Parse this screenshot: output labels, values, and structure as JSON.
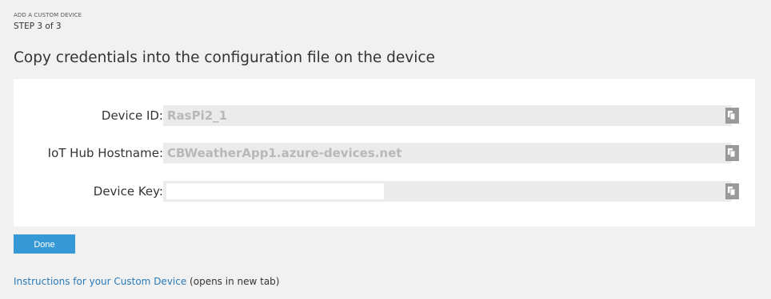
{
  "wizard": {
    "title": "ADD A CUSTOM DEVICE",
    "step": "STEP 3 of 3"
  },
  "heading": "Copy credentials into the configuration file on the device",
  "fields": [
    {
      "label": "Device ID:",
      "value": "RasPi2_1",
      "copy_icon": "copy-icon"
    },
    {
      "label": "IoT Hub Hostname:",
      "value": "CBWeatherApp1.azure-devices.net",
      "copy_icon": "copy-icon"
    },
    {
      "label": "Device Key:",
      "value": "",
      "copy_icon": "copy-icon"
    }
  ],
  "actions": {
    "done_label": "Done"
  },
  "footer": {
    "link_text": "Instructions for your Custom Device",
    "suffix": " (opens in new tab)"
  },
  "colors": {
    "page_background": "#f1f1f1",
    "panel_background": "#ffffff",
    "field_background": "#ebebeb",
    "field_text": "#b8b8b8",
    "button_primary": "#3798d6",
    "link": "#2a7ab8",
    "copy_button": "#9a9a9a"
  }
}
